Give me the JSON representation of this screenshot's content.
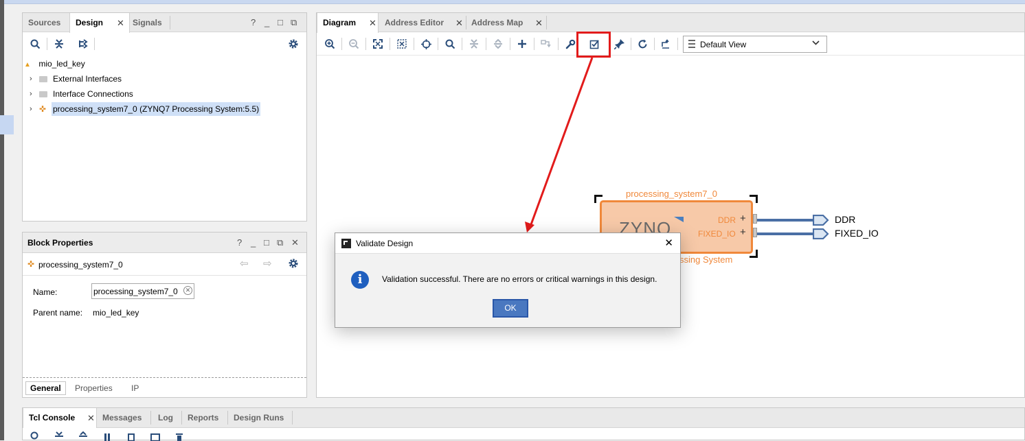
{
  "colors": {
    "accent": "#2a57a8",
    "highlight": "#e21b1b",
    "ip_block": "#f7c9a8",
    "ip_border": "#f0883a",
    "port_line": "#4a6fa5"
  },
  "left_panel": {
    "tabs": [
      {
        "label": "Sources",
        "active": false
      },
      {
        "label": "Design",
        "active": true,
        "closable": true
      },
      {
        "label": "Signals",
        "active": false
      }
    ],
    "window_buttons": [
      "?",
      "_",
      "□",
      "⧉"
    ],
    "toolbar_icons": [
      "search-icon",
      "collapse-all-icon",
      "expand-all-icon",
      "gear-icon"
    ],
    "tree": {
      "root": "mio_led_key",
      "items": [
        {
          "label": "External Interfaces",
          "icon": "folder-icon"
        },
        {
          "label": "Interface Connections",
          "icon": "folder-icon"
        },
        {
          "label": "processing_system7_0 (ZYNQ7 Processing System:5.5)",
          "icon": "ip-icon",
          "selected": true
        }
      ]
    }
  },
  "block_props": {
    "title": "Block Properties",
    "window_buttons": [
      "?",
      "_",
      "□",
      "⧉",
      "✕"
    ],
    "selected_name": "processing_system7_0",
    "fields": {
      "name_label": "Name:",
      "name_value": "processing_system7_0",
      "parent_label": "Parent name:",
      "parent_value": "mio_led_key"
    },
    "bottom_tabs": [
      {
        "label": "General",
        "active": true
      },
      {
        "label": "Properties",
        "active": false
      },
      {
        "label": "IP",
        "active": false
      }
    ]
  },
  "diagram": {
    "tabs": [
      {
        "label": "Diagram",
        "active": true,
        "closable": true
      },
      {
        "label": "Address Editor",
        "active": false,
        "closable": true
      },
      {
        "label": "Address Map",
        "active": false,
        "closable": true
      }
    ],
    "toolbar_icons": [
      "zoom-in-icon",
      "zoom-out-icon",
      "fit-icon",
      "zoom-area-icon",
      "crosshair-icon",
      "search-icon",
      "collapse-icon",
      "expand-icon",
      "add-ip-icon",
      "make-connection-icon",
      "wrench-icon",
      "validate-design-icon",
      "pin-icon",
      "regenerate-layout-icon",
      "optimize-routing-icon"
    ],
    "highlighted_tool": "validate-design-icon",
    "view_select": "Default View",
    "block": {
      "instance_name": "processing_system7_0",
      "logo_text": "ZYNQ",
      "subtitle": "ssing System",
      "ports": [
        {
          "label": "DDR",
          "external": "DDR"
        },
        {
          "label": "FIXED_IO",
          "external": "FIXED_IO"
        }
      ]
    }
  },
  "dialog": {
    "title": "Validate Design",
    "message": "Validation successful. There are no errors or critical warnings in this design.",
    "ok_label": "OK"
  },
  "console": {
    "tabs": [
      {
        "label": "Tcl Console",
        "active": true,
        "closable": true
      },
      {
        "label": "Messages",
        "active": false
      },
      {
        "label": "Log",
        "active": false
      },
      {
        "label": "Reports",
        "active": false
      },
      {
        "label": "Design Runs",
        "active": false
      }
    ]
  }
}
